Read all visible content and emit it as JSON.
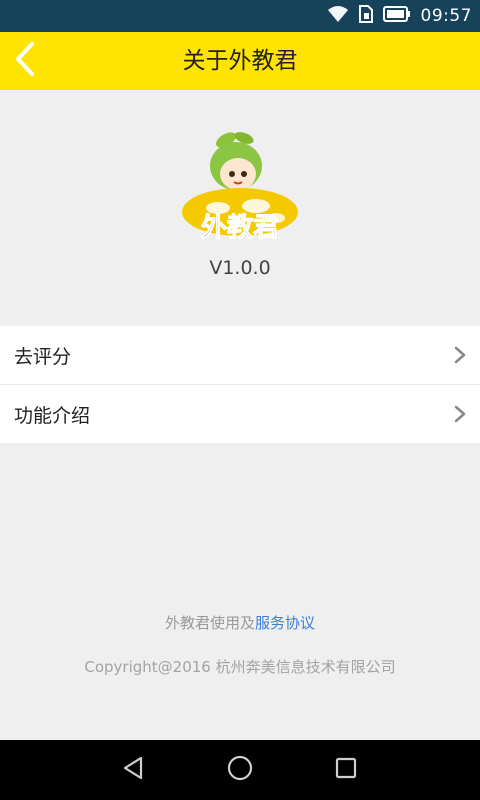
{
  "status_bar": {
    "time": "09:57",
    "icons": [
      "wifi-icon",
      "sim-icon",
      "battery-icon"
    ]
  },
  "header": {
    "title": "关于外教君",
    "back_icon": "chevron-left-icon"
  },
  "app_info": {
    "logo_text": "外教君",
    "version": "V1.0.0"
  },
  "menu": {
    "items": [
      {
        "label": "去评分",
        "icon": "chevron-right-icon"
      },
      {
        "label": "功能介绍",
        "icon": "chevron-right-icon"
      }
    ]
  },
  "footer": {
    "agreement_prefix": "外教君使用及",
    "agreement_link": "服务协议",
    "copyright": "Copyright@2016 杭州奔美信息技术有限公司"
  },
  "nav_bar": {
    "icons": [
      "back-triangle-icon",
      "home-circle-icon",
      "recents-square-icon"
    ]
  },
  "colors": {
    "header_bg": "#ffe400",
    "status_bg": "#16425a",
    "page_bg": "#efefef",
    "link": "#3d7fd6"
  }
}
